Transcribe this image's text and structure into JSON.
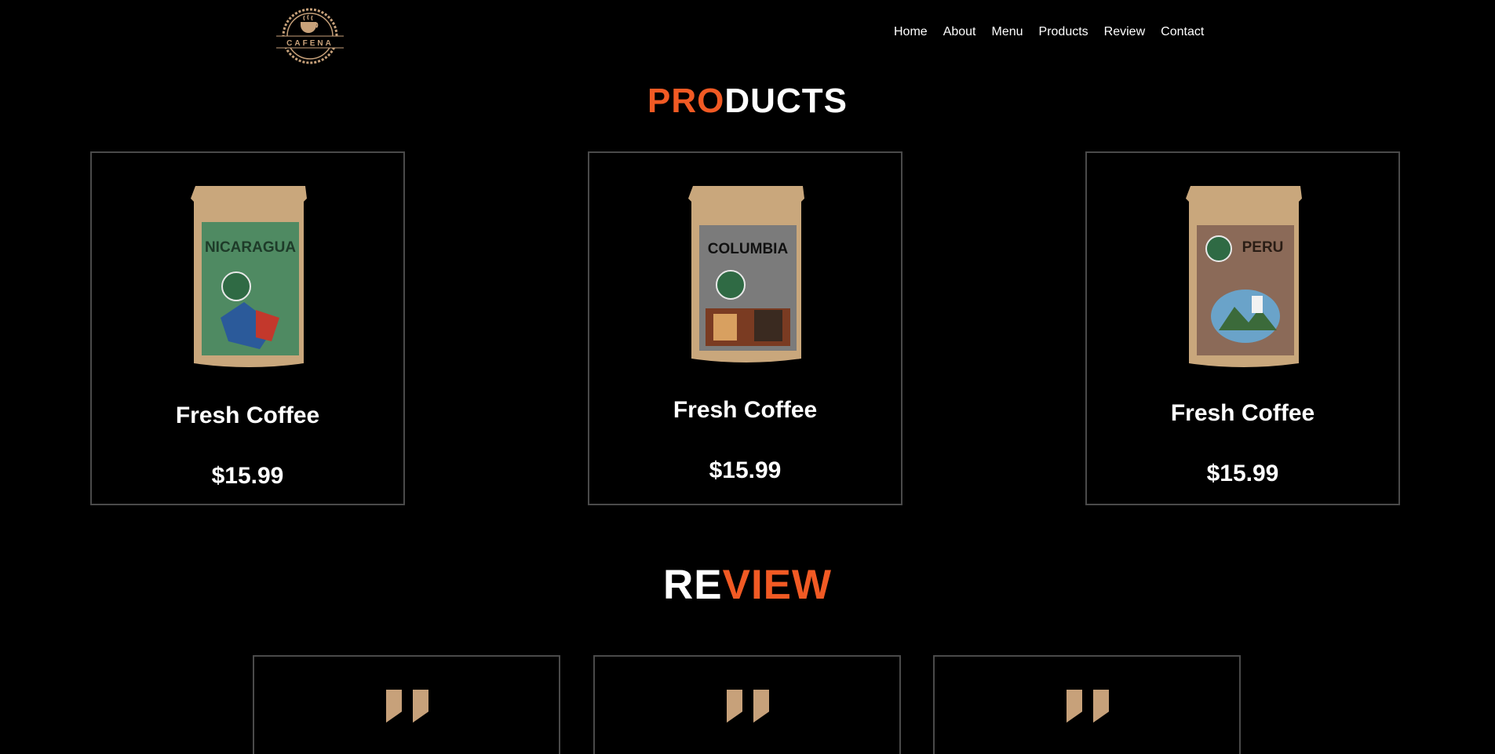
{
  "brand": {
    "logo_text": "CAFENA"
  },
  "nav": {
    "items": [
      "Home",
      "About",
      "Menu",
      "Products",
      "Review",
      "Contact"
    ]
  },
  "products_section": {
    "heading_accent": "PRO",
    "heading_rest": "DUCTS",
    "items": [
      {
        "title": "Fresh Coffee",
        "price": "$15.99",
        "bag_label": "NICARAGUA",
        "bag_color": "#4f8a62"
      },
      {
        "title": "Fresh Coffee",
        "price": "$15.99",
        "bag_label": "COLUMBIA",
        "bag_color": "#7b7b7b"
      },
      {
        "title": "Fresh Coffee",
        "price": "$15.99",
        "bag_label": "PERU",
        "bag_color": "#8b6a58"
      }
    ]
  },
  "review_section": {
    "heading_plain": "RE",
    "heading_accent": "VIEW",
    "quote_color": "#c7a17a"
  },
  "colors": {
    "accent": "#f15a24",
    "background": "#000000",
    "card_border": "#4a4a4a",
    "kraft": "#c9a77c"
  }
}
